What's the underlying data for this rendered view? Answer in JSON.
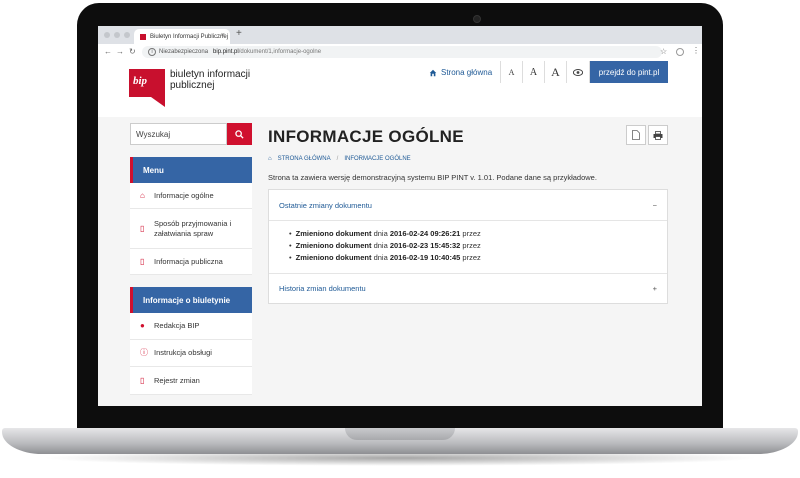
{
  "browser": {
    "tab_title": "Biuletyn Informacji Publicznej",
    "tab_close": "×",
    "new_tab": "+",
    "security_label": "Niezabezpieczona",
    "url_host": "bip.pint.pl",
    "url_path": "/dokument/1,informacje-ogolne"
  },
  "header": {
    "logo_text": "bip",
    "site_name": "biuletyn informacji publicznej",
    "home_link": "Strona główna",
    "font_buttons": [
      "A",
      "A",
      "A"
    ],
    "pint_button": "przejdź do pint.pl"
  },
  "sidebar": {
    "search_placeholder": "Wyszukaj",
    "menu_title": "Menu",
    "menu_items": [
      {
        "label": "Informacje ogólne",
        "icon": "home-icon"
      },
      {
        "label": "Sposób przyjmowania i załatwiania spraw",
        "icon": "document-icon"
      },
      {
        "label": "Informacja publiczna",
        "icon": "document-icon"
      }
    ],
    "about_title": "Informacje o biuletynie",
    "about_items": [
      {
        "label": "Redakcja BIP",
        "icon": "user-icon"
      },
      {
        "label": "Instrukcja obsługi",
        "icon": "info-icon"
      },
      {
        "label": "Rejestr zmian",
        "icon": "document-icon"
      }
    ]
  },
  "main": {
    "title": "INFORMACJE OGÓLNE",
    "breadcrumb": [
      "STRONA GŁÓWNA",
      "INFORMACJE OGÓLNE"
    ],
    "breadcrumb_sep": "/",
    "intro": "Strona ta zawiera wersję demonstracyjną systemu BIP PINT v. 1.01. Podane dane są przykładowe.",
    "recent_changes": {
      "title": "Ostatnie zmiany dokumentu",
      "toggle": "−",
      "items": [
        {
          "label": "Zmieniono dokument",
          "mid": " dnia ",
          "date": "2016-02-24 09:26:21",
          "tail": " przez"
        },
        {
          "label": "Zmieniono dokument",
          "mid": " dnia ",
          "date": "2016-02-23 15:45:32",
          "tail": " przez"
        },
        {
          "label": "Zmieniono dokument",
          "mid": " dnia ",
          "date": "2016-02-19 10:40:45",
          "tail": " przez"
        }
      ]
    },
    "history": {
      "title": "Historia zmian dokumentu",
      "toggle": "+"
    }
  },
  "colors": {
    "brand_red": "#c8102e",
    "brand_blue": "#3565a5",
    "link_blue": "#1f5a96"
  }
}
